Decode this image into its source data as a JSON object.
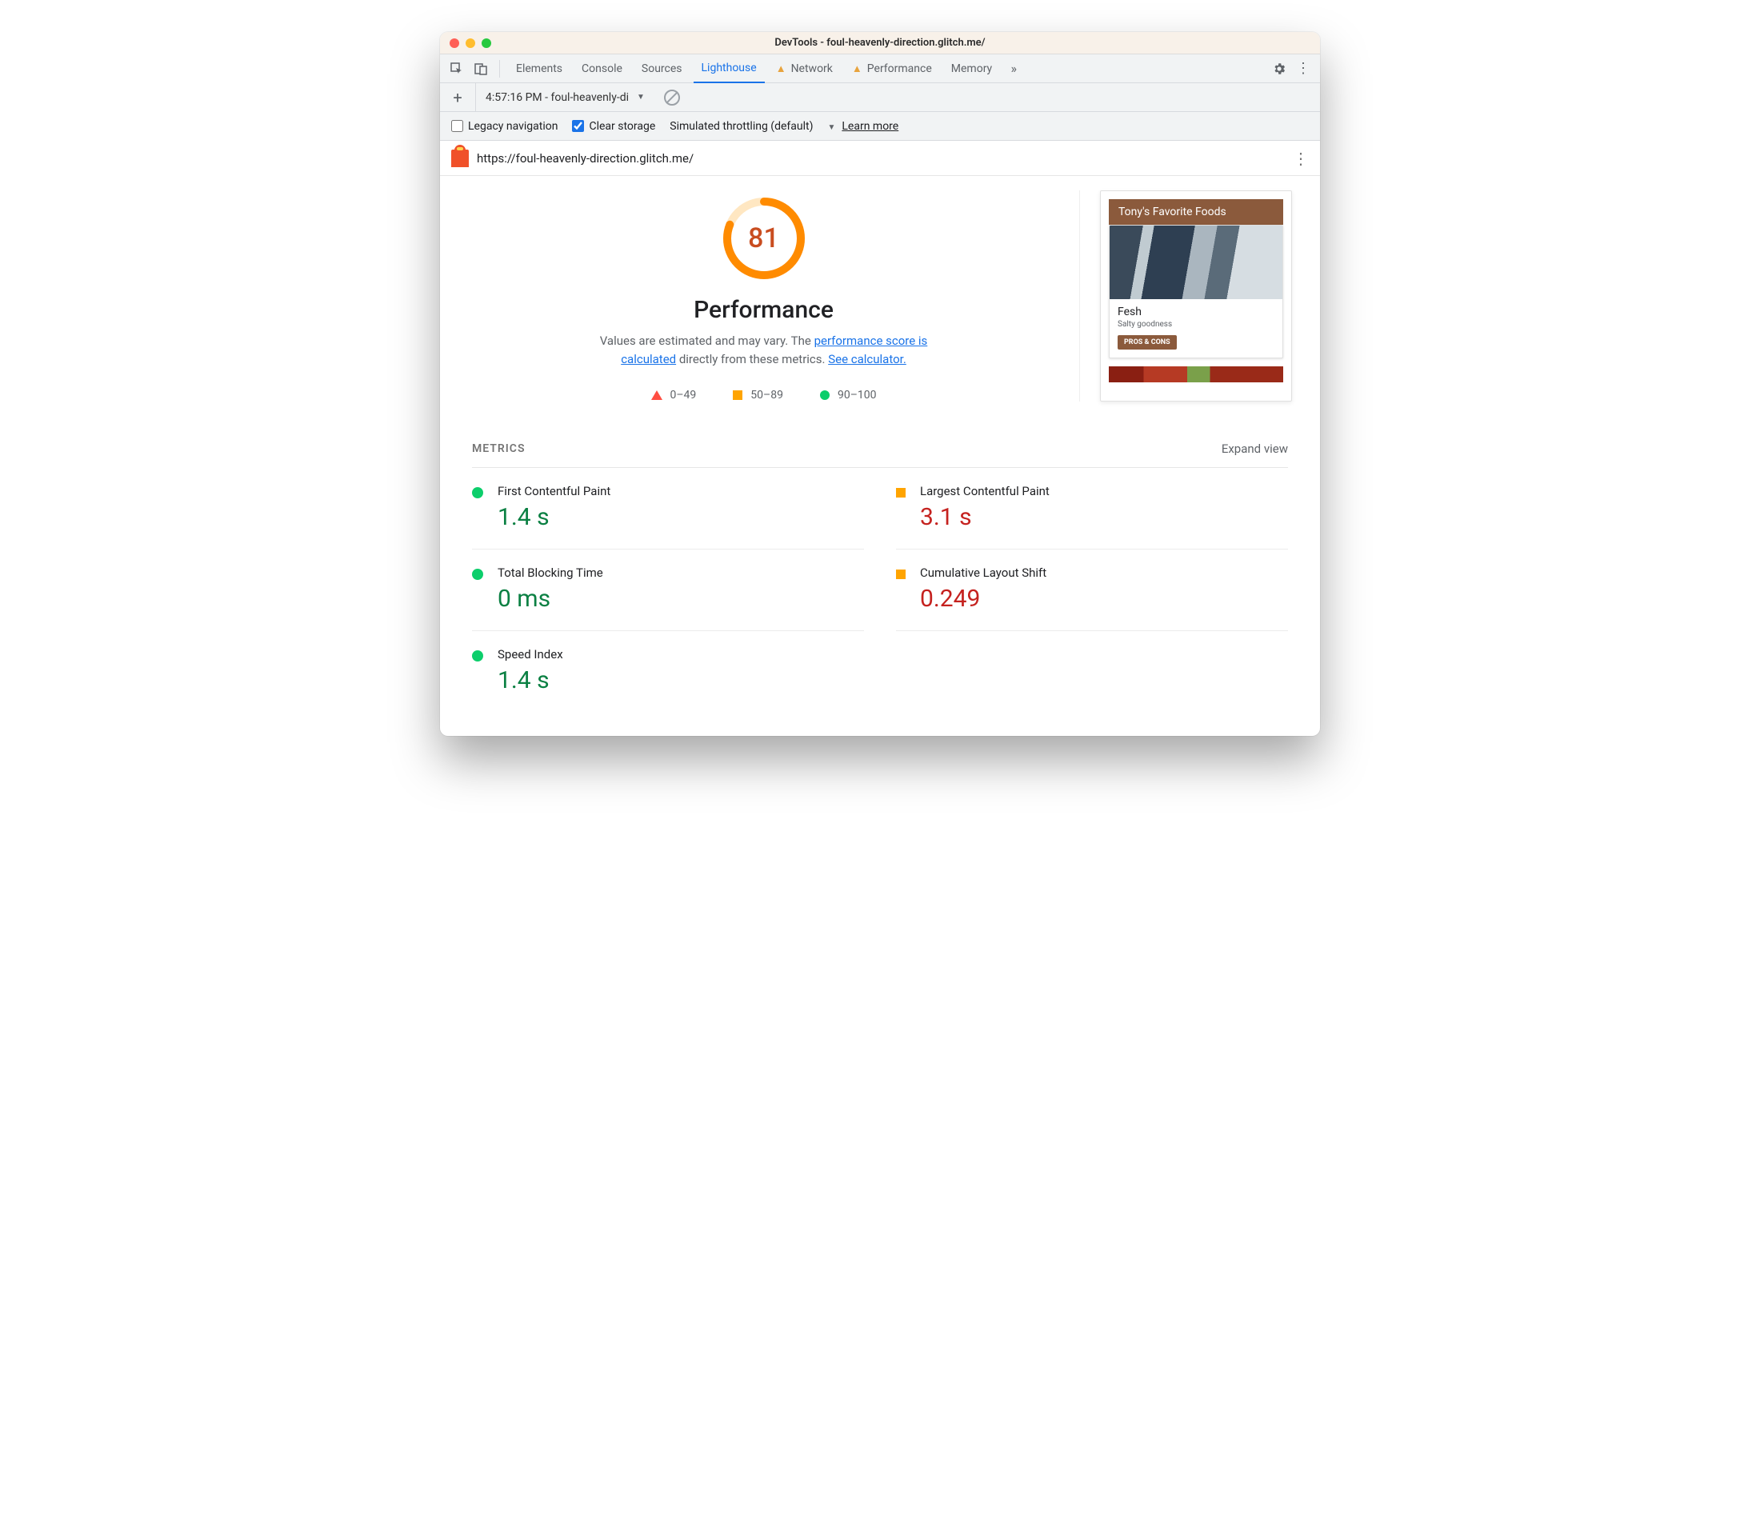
{
  "titlebar": {
    "title": "DevTools - foul-heavenly-direction.glitch.me/"
  },
  "tabs": {
    "items": [
      "Elements",
      "Console",
      "Sources",
      "Lighthouse",
      "Network",
      "Performance",
      "Memory"
    ],
    "active_index": 3,
    "warn_indices": [
      4,
      5
    ]
  },
  "toolbar": {
    "report_label": "4:57:16 PM - foul-heavenly-di"
  },
  "options": {
    "legacy_label": "Legacy navigation",
    "legacy_checked": false,
    "clear_label": "Clear storage",
    "clear_checked": true,
    "throttle_label": "Simulated throttling (default)",
    "learn_more": "Learn more"
  },
  "url": "https://foul-heavenly-direction.glitch.me/",
  "gauge": {
    "score": "81",
    "percent": 81
  },
  "performance": {
    "title": "Performance",
    "desc_prefix": "Values are estimated and may vary. The ",
    "link1": "performance score is calculated",
    "desc_mid": " directly from these metrics. ",
    "link2": "See calculator."
  },
  "legend": {
    "r": "0–49",
    "o": "50–89",
    "g": "90–100"
  },
  "preview": {
    "header": "Tony's Favorite Foods",
    "item_name": "Fesh",
    "item_sub": "Salty goodness",
    "item_btn": "PROS & CONS"
  },
  "metrics": {
    "heading": "METRICS",
    "expand": "Expand view",
    "items": [
      {
        "label": "First Contentful Paint",
        "value": "1.4 s",
        "status": "green"
      },
      {
        "label": "Largest Contentful Paint",
        "value": "3.1 s",
        "status": "orange"
      },
      {
        "label": "Total Blocking Time",
        "value": "0 ms",
        "status": "green"
      },
      {
        "label": "Cumulative Layout Shift",
        "value": "0.249",
        "status": "orange"
      },
      {
        "label": "Speed Index",
        "value": "1.4 s",
        "status": "green"
      }
    ]
  }
}
